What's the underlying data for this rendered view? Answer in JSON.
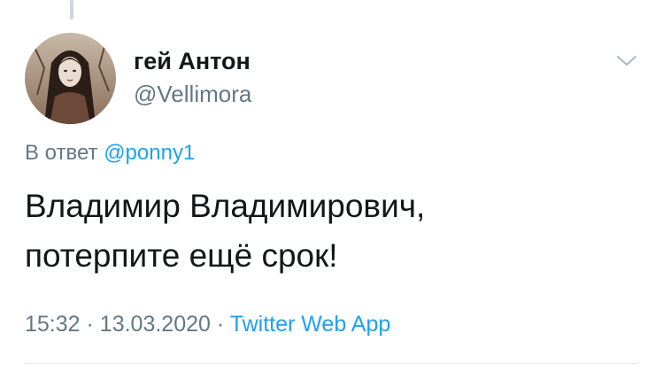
{
  "tweet": {
    "author": {
      "display_name": "гей Антон",
      "handle": "@Vellimora"
    },
    "reply": {
      "prefix": "В ответ",
      "mention": "@ponny1"
    },
    "text_lines": [
      "Владимир Владимирович,",
      "потерпите ещё срок!"
    ],
    "time": "15:32",
    "separator": "·",
    "date": "13.03.2020",
    "source": "Twitter Web App"
  },
  "icons": {
    "menu": "chevron-down-icon",
    "avatar": "user-avatar"
  },
  "colors": {
    "link": "#1da1f2",
    "secondary_text": "#657786",
    "primary_text": "#14171a",
    "divider": "#e1e8ed",
    "thread_line": "#ccd6dd"
  }
}
